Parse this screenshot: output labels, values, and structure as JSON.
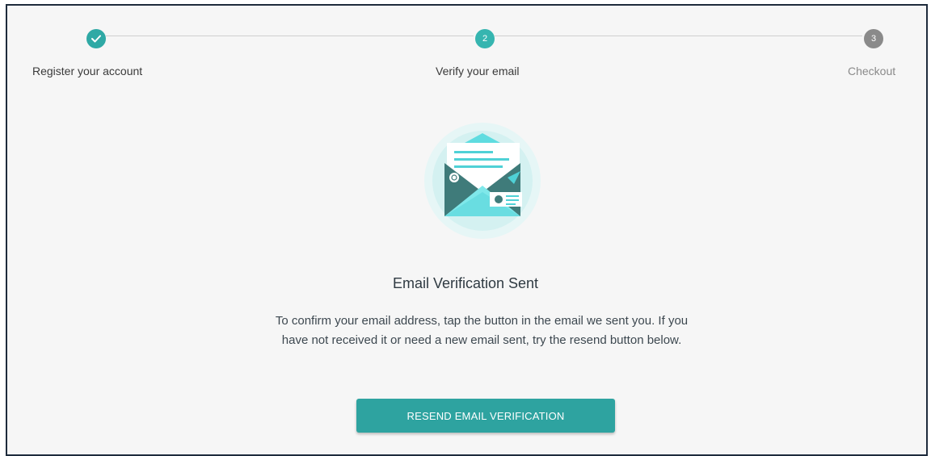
{
  "stepper": {
    "steps": [
      {
        "number": "1",
        "label": "Register your account",
        "state": "done",
        "icon": "check-icon"
      },
      {
        "number": "2",
        "label": "Verify your email",
        "state": "active"
      },
      {
        "number": "3",
        "label": "Checkout",
        "state": "pending"
      }
    ]
  },
  "illustration": {
    "icon": "envelope-illustration"
  },
  "content": {
    "title": "Email Verification Sent",
    "description": "To confirm your email address, tap the button in the email we sent you. If you have not received it or need a new email sent, try the resend button below.",
    "resend_label": "RESEND EMAIL VERIFICATION"
  },
  "colors": {
    "accent": "#2ea3a0",
    "pending": "#8a8a8a",
    "frame_border": "#1e2b3c"
  }
}
